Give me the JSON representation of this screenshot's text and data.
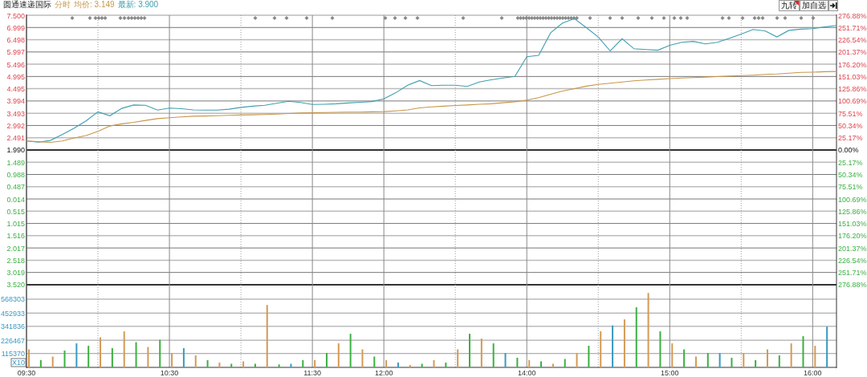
{
  "header": {
    "name": "圆通速递国际",
    "mode": "分时",
    "average": "均价: 3.149",
    "latest": "最新: 3.900"
  },
  "buttons": [
    {
      "label": "九转",
      "flagged": true
    },
    {
      "label": "加自选",
      "flagged": false
    }
  ],
  "price_chart": {
    "chart_data": {
      "type": "line",
      "categories": [
        null,
        null,
        null,
        null,
        null,
        null,
        null,
        null,
        null,
        null,
        null,
        null,
        null,
        null,
        null,
        null,
        null,
        null,
        null,
        null,
        null,
        null,
        null,
        null,
        null,
        null,
        null,
        null,
        null,
        null,
        null,
        null,
        null,
        null,
        null,
        null,
        null,
        null,
        null,
        null,
        null,
        null,
        null,
        null,
        null,
        null,
        null,
        null,
        null,
        null,
        null,
        null,
        null,
        null,
        null,
        null,
        null,
        null,
        null,
        null,
        null,
        null,
        null,
        null,
        null,
        null,
        null,
        null,
        null
      ],
      "series": [
        {
          "color": "#3f9fb0",
          "values": [
            2.36,
            2.31,
            2.38,
            2.62,
            2.88,
            3.18,
            3.55,
            3.39,
            3.69,
            3.83,
            3.82,
            3.62,
            3.7,
            3.68,
            3.63,
            3.62,
            3.62,
            3.66,
            3.73,
            3.78,
            3.82,
            3.9,
            3.98,
            3.93,
            3.85,
            3.86,
            3.88,
            3.91,
            3.94,
            3.97,
            4.08,
            4.33,
            4.64,
            4.83,
            4.62,
            4.64,
            4.64,
            4.59,
            4.77,
            4.86,
            4.93,
            5.0,
            5.8,
            5.86,
            6.78,
            7.18,
            7.36,
            6.99,
            6.61,
            6.04,
            6.54,
            6.13,
            6.1,
            6.07,
            6.27,
            6.39,
            6.43,
            6.33,
            6.39,
            6.56,
            6.73,
            6.92,
            6.86,
            6.61,
            6.88,
            6.93,
            6.95,
            7.02,
            7.08
          ]
        },
        {
          "color": "#c8964a",
          "values": [
            2.36,
            2.33,
            2.3,
            2.36,
            2.48,
            2.58,
            2.75,
            2.97,
            3.06,
            3.12,
            3.2,
            3.27,
            3.31,
            3.34,
            3.37,
            3.38,
            3.39,
            3.41,
            3.42,
            3.43,
            3.44,
            3.46,
            3.48,
            3.5,
            3.51,
            3.52,
            3.53,
            3.54,
            3.54,
            3.55,
            3.56,
            3.59,
            3.63,
            3.71,
            3.75,
            3.78,
            3.81,
            3.83,
            3.86,
            3.88,
            3.92,
            3.96,
            4.03,
            4.13,
            4.27,
            4.4,
            4.5,
            4.6,
            4.67,
            4.72,
            4.77,
            4.82,
            4.85,
            4.88,
            4.91,
            4.93,
            4.95,
            4.97,
            4.99,
            5.01,
            5.03,
            5.05,
            5.08,
            5.1,
            5.13,
            5.16,
            5.17,
            5.19,
            5.2
          ]
        }
      ],
      "ylim": [
        1.99,
        7.5
      ],
      "grid": true,
      "yticks": [
        {
          "value": 7.5,
          "label": "7.500"
        },
        {
          "value": 6.999,
          "label": "6.999"
        },
        {
          "value": 6.498,
          "label": "6.498"
        },
        {
          "value": 5.997,
          "label": "5.997"
        },
        {
          "value": 5.496,
          "label": "5.496"
        },
        {
          "value": 4.995,
          "label": "4.995"
        },
        {
          "value": 4.495,
          "label": "4.495"
        },
        {
          "value": 3.994,
          "label": "3.994"
        },
        {
          "value": 3.493,
          "label": "3.493"
        },
        {
          "value": 2.992,
          "label": "2.992"
        },
        {
          "value": 2.491,
          "label": "2.491"
        },
        {
          "value": 1.99,
          "label": "1.990"
        }
      ]
    },
    "right_labels": [
      "276.88%",
      "251.71%",
      "226.54%",
      "201.37%",
      "176.20%",
      "151.03%",
      "125.86%",
      "100.69%",
      "75.51%",
      "50.34%",
      "25.17%",
      "0.00%"
    ]
  },
  "lower_panel": {
    "left_labels": [
      "1.489",
      "0.988",
      "0.487",
      "0.014",
      "0.515",
      "1.015",
      "1.516",
      "2.017",
      "2.518",
      "3.019",
      "3.520"
    ],
    "right_labels": [
      "25.17%",
      "50.34%",
      "75.51%",
      "100.69%",
      "125.86%",
      "151.03%",
      "176.20%",
      "201.37%",
      "226.54%",
      "251.71%",
      "276.88%"
    ]
  },
  "volume_chart": {
    "unit_label": "X10",
    "chart_data": {
      "type": "bar",
      "categories": [
        "09:30",
        null,
        null,
        null,
        null,
        null,
        null,
        null,
        null,
        null,
        null,
        null,
        "10:30",
        null,
        null,
        null,
        null,
        null,
        null,
        null,
        null,
        null,
        null,
        null,
        "11:30",
        null,
        null,
        null,
        null,
        null,
        "12:00",
        null,
        null,
        null,
        null,
        null,
        null,
        null,
        null,
        null,
        null,
        null,
        "14:00",
        null,
        null,
        null,
        null,
        null,
        null,
        null,
        null,
        null,
        null,
        null,
        "15:00",
        null,
        null,
        null,
        null,
        null,
        null,
        null,
        null,
        null,
        null,
        null,
        "16:00",
        null
      ],
      "series": [
        {
          "color": "#d49a55",
          "values": [
            150000,
            null,
            90000,
            null,
            null,
            null,
            250000,
            null,
            300000,
            null,
            170000,
            null,
            120000,
            null,
            100000,
            null,
            40000,
            null,
            50000,
            null,
            520000,
            null,
            null,
            null,
            60000,
            null,
            200000,
            null,
            150000,
            null,
            60000,
            null,
            20000,
            null,
            60000,
            null,
            150000,
            null,
            240000,
            null,
            null,
            null,
            60000,
            null,
            30000,
            null,
            120000,
            null,
            300000,
            null,
            400000,
            null,
            620000,
            null,
            200000,
            null,
            90000,
            null,
            null,
            null,
            120000,
            null,
            150000,
            null,
            200000,
            null,
            180000,
            null
          ]
        },
        {
          "color": "#3cb043",
          "values": [
            null,
            60000,
            null,
            140000,
            null,
            180000,
            null,
            160000,
            null,
            210000,
            null,
            230000,
            null,
            null,
            null,
            60000,
            null,
            30000,
            null,
            30000,
            null,
            25000,
            null,
            60000,
            null,
            120000,
            null,
            280000,
            null,
            90000,
            null,
            null,
            null,
            30000,
            null,
            40000,
            null,
            280000,
            null,
            200000,
            null,
            80000,
            null,
            50000,
            null,
            70000,
            null,
            180000,
            null,
            null,
            null,
            500000,
            null,
            300000,
            null,
            150000,
            null,
            120000,
            null,
            80000,
            null,
            60000,
            null,
            100000,
            null,
            260000,
            null,
            null
          ]
        },
        {
          "color": "#3a9ac0",
          "values": [
            null,
            null,
            null,
            null,
            200000,
            null,
            null,
            null,
            null,
            null,
            null,
            null,
            null,
            160000,
            null,
            null,
            null,
            null,
            null,
            null,
            null,
            null,
            30000,
            null,
            null,
            null,
            null,
            null,
            null,
            null,
            null,
            40000,
            null,
            null,
            null,
            null,
            null,
            null,
            null,
            null,
            120000,
            null,
            null,
            null,
            null,
            null,
            null,
            null,
            null,
            350000,
            null,
            null,
            null,
            null,
            null,
            null,
            null,
            null,
            120000,
            null,
            null,
            null,
            null,
            null,
            null,
            null,
            null,
            340000
          ]
        }
      ],
      "ylim": [
        0,
        689000
      ],
      "grid": true,
      "yticks": [
        {
          "value": 115370,
          "label": "115370"
        },
        {
          "value": 226467,
          "label": "226467"
        },
        {
          "value": 341836,
          "label": "341836"
        },
        {
          "value": 452933,
          "label": "452933"
        },
        {
          "value": 568303,
          "label": "568303"
        }
      ]
    }
  }
}
